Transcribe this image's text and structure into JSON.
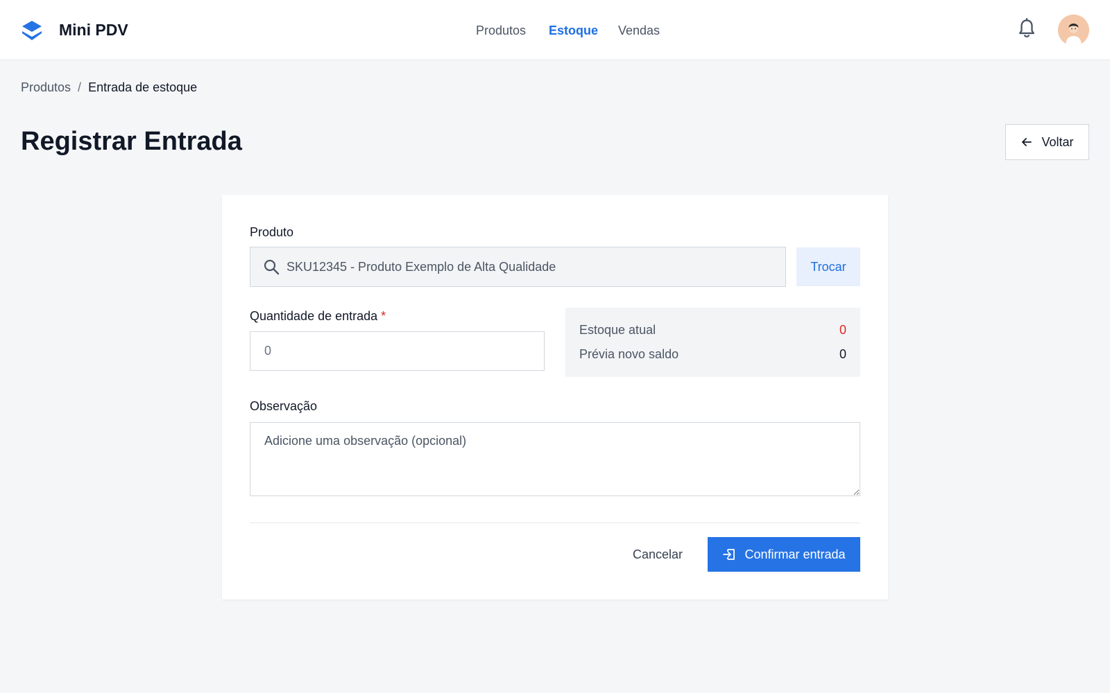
{
  "app": {
    "name": "Mini PDV",
    "brand_color": "#2673e5"
  },
  "nav": {
    "items": [
      {
        "label": "Produtos",
        "active": false
      },
      {
        "label": "Estoque",
        "active": true
      },
      {
        "label": "Vendas",
        "active": false
      }
    ]
  },
  "header_icons": [
    "bell-icon",
    "user-avatar"
  ],
  "breadcrumb": {
    "parent": "Produtos",
    "separator": "/",
    "current": "Entrada de estoque"
  },
  "page": {
    "title": "Registrar Entrada",
    "back_label": "Voltar"
  },
  "form": {
    "product_label": "Produto",
    "product_value": "SKU12345 - Produto Exemplo de Alta Qualidade",
    "swap_label": "Trocar",
    "quantity_label": "Quantidade de entrada",
    "quantity_required_mark": "*",
    "quantity_placeholder": "0",
    "stock_current_label": "Estoque atual",
    "stock_current_value": "0",
    "stock_preview_label": "Prévia novo saldo",
    "stock_preview_value": "0",
    "notes_label": "Observação",
    "notes_placeholder": "Adicione uma observação (opcional)",
    "cancel_label": "Cancelar",
    "confirm_label": "Confirmar entrada"
  },
  "colors": {
    "active_nav": "#1f6fe0",
    "danger": "#dc2626",
    "primary_button": "#2673e5"
  }
}
